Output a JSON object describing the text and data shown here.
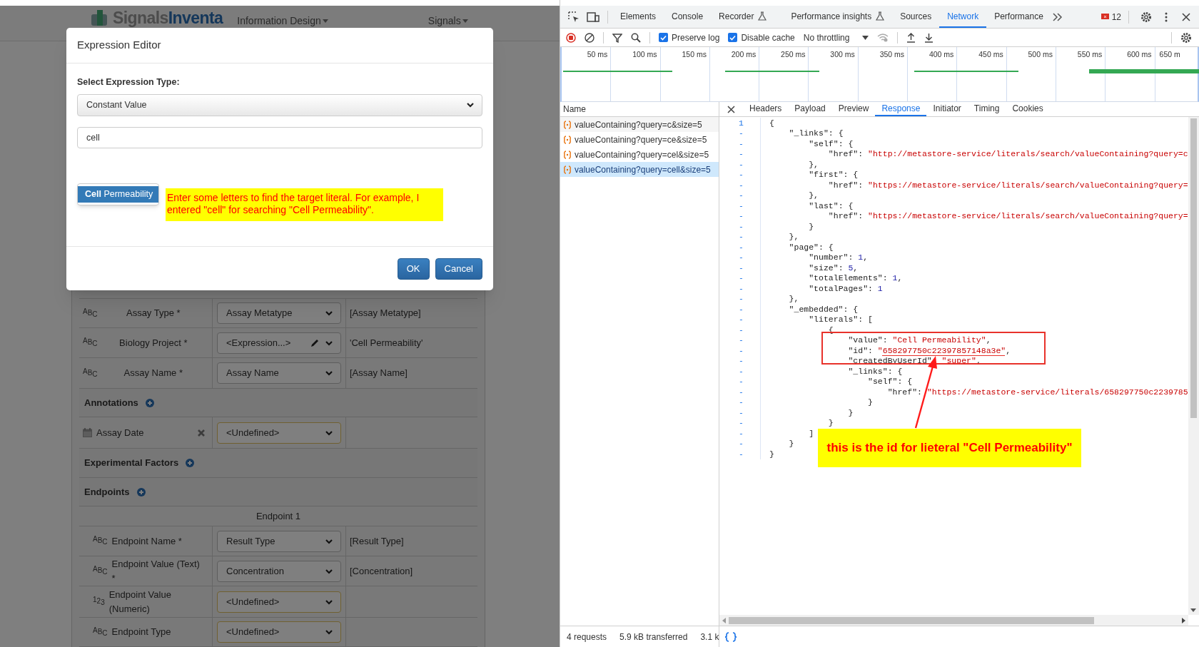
{
  "app": {
    "logo": {
      "prefix": "Signals",
      "suffix": "Inventa"
    },
    "nav": [
      "Information Design",
      "Signals"
    ],
    "form_rows": [
      {
        "kind": "field",
        "type_glyph": "ABC",
        "label": "Assay Type *",
        "select": "Assay Metatype",
        "undefined": false,
        "editable": false,
        "removable": false,
        "value": "[Assay Metatype]"
      },
      {
        "kind": "field",
        "type_glyph": "ABC",
        "label": "Biology Project *",
        "select": "<Expression...>",
        "undefined": false,
        "editable": true,
        "removable": false,
        "value": "'Cell Permeability'"
      },
      {
        "kind": "field",
        "type_glyph": "ABC",
        "label": "Assay Name *",
        "select": "Assay Name",
        "undefined": false,
        "editable": false,
        "removable": false,
        "value": "[Assay Name]"
      },
      {
        "kind": "section",
        "label": "Annotations"
      },
      {
        "kind": "date_field",
        "label": "Assay Date",
        "select": "<Undefined>",
        "undefined": true,
        "editable": false,
        "removable": true
      },
      {
        "kind": "section",
        "label": "Experimental Factors"
      },
      {
        "kind": "section",
        "label": "Endpoints"
      },
      {
        "kind": "subheader",
        "label": "Endpoint 1"
      },
      {
        "kind": "field",
        "type_glyph": "ABC",
        "label": "Endpoint Name *",
        "select": "Result Type",
        "undefined": false,
        "editable": false,
        "removable": false,
        "value": "[Result Type]"
      },
      {
        "kind": "field",
        "type_glyph": "ABC",
        "label": "Endpoint Value (Text) *",
        "select": "Concentration",
        "undefined": false,
        "editable": false,
        "removable": false,
        "value": "[Concentration]"
      },
      {
        "kind": "field",
        "type_glyph": "123",
        "label": "Endpoint Value (Numeric)",
        "select": "<Undefined>",
        "undefined": true,
        "editable": false,
        "removable": false
      },
      {
        "kind": "field",
        "type_glyph": "ABC",
        "label": "Endpoint Type",
        "select": "<Undefined>",
        "undefined": true,
        "editable": false,
        "removable": false
      }
    ]
  },
  "modal": {
    "title": "Expression Editor",
    "type_label": "Select Expression Type:",
    "type_value": "Constant Value",
    "search_value": "cell",
    "suggestions": [
      {
        "label": "**Cell** Permeability",
        "selected": true
      }
    ],
    "note": "Enter some letters to find the target literal. For example, I entered \"cell\" for searching \"Cell Permeability\".",
    "buttons": [
      {
        "label": "OK"
      },
      {
        "label": "Cancel"
      }
    ]
  },
  "devtools": {
    "tabs": [
      {
        "label": "Elements",
        "selected": false,
        "experimental": false
      },
      {
        "label": "Console",
        "selected": false,
        "experimental": false
      },
      {
        "label": "Recorder",
        "selected": false,
        "experimental": true
      },
      {
        "label": "Performance insights",
        "selected": false,
        "experimental": true
      },
      {
        "label": "Sources",
        "selected": false,
        "experimental": false
      },
      {
        "label": "Network",
        "selected": true,
        "experimental": false
      },
      {
        "label": "Performance",
        "selected": false,
        "experimental": false
      }
    ],
    "error_count": "12",
    "preserve_log": {
      "label": "Preserve log",
      "checked": true
    },
    "disable_cache": {
      "label": "Disable cache",
      "checked": true
    },
    "throttling": "No throttling",
    "timeline_ticks": [
      "50 ms",
      "100 ms",
      "150 ms",
      "200 ms",
      "250 ms",
      "300 ms",
      "350 ms",
      "400 ms",
      "450 ms",
      "500 ms",
      "550 ms",
      "600 ms",
      "650 m"
    ],
    "requests_header": "Name",
    "requests": [
      {
        "label": "valueContaining?query=c&size=5",
        "selected": false
      },
      {
        "label": "valueContaining?query=ce&size=5",
        "selected": false
      },
      {
        "label": "valueContaining?query=cel&size=5",
        "selected": false
      },
      {
        "label": "valueContaining?query=cell&size=5",
        "selected": true
      }
    ],
    "detail_tabs": [
      {
        "label": "Headers",
        "selected": false
      },
      {
        "label": "Payload",
        "selected": false
      },
      {
        "label": "Preview",
        "selected": false
      },
      {
        "label": "Response",
        "selected": true
      },
      {
        "label": "Initiator",
        "selected": false
      },
      {
        "label": "Timing",
        "selected": false
      },
      {
        "label": "Cookies",
        "selected": false
      }
    ],
    "response_lines": [
      {
        "gutter": "1",
        "code": "{"
      },
      {
        "gutter": "-",
        "code": "    \"_links\": {"
      },
      {
        "gutter": "-",
        "code": "        \"self\": {"
      },
      {
        "gutter": "-",
        "code": "            \"href\": \"http://metastore-service/literals/search/valueContaining?query=c"
      },
      {
        "gutter": "-",
        "code": "        },"
      },
      {
        "gutter": "-",
        "code": "        \"first\": {"
      },
      {
        "gutter": "-",
        "code": "            \"href\": \"https://metastore-service/literals/search/valueContaining?query="
      },
      {
        "gutter": "-",
        "code": "        },"
      },
      {
        "gutter": "-",
        "code": "        \"last\": {"
      },
      {
        "gutter": "-",
        "code": "            \"href\": \"https://metastore-service/literals/search/valueContaining?query="
      },
      {
        "gutter": "-",
        "code": "        }"
      },
      {
        "gutter": "-",
        "code": "    },"
      },
      {
        "gutter": "-",
        "code": "    \"page\": {"
      },
      {
        "gutter": "-",
        "code": "        \"number\": 1,"
      },
      {
        "gutter": "-",
        "code": "        \"size\": 5,"
      },
      {
        "gutter": "-",
        "code": "        \"totalElements\": 1,"
      },
      {
        "gutter": "-",
        "code": "        \"totalPages\": 1"
      },
      {
        "gutter": "-",
        "code": "    },"
      },
      {
        "gutter": "-",
        "code": "    \"_embedded\": {"
      },
      {
        "gutter": "-",
        "code": "        \"literals\": ["
      },
      {
        "gutter": "-",
        "code": "            {"
      },
      {
        "gutter": "-",
        "code": "                \"value\": \"Cell Permeability\","
      },
      {
        "gutter": "-",
        "code": "                \"id\": \"658297750c22397857148a3e\","
      },
      {
        "gutter": "-",
        "code": "                \"createdByUserId\": \"super\","
      },
      {
        "gutter": "-",
        "code": "                \"_links\": {"
      },
      {
        "gutter": "-",
        "code": "                    \"self\": {"
      },
      {
        "gutter": "-",
        "code": "                        \"href\": \"https://metastore-service/literals/658297750c2239785"
      },
      {
        "gutter": "-",
        "code": "                    }"
      },
      {
        "gutter": "-",
        "code": "                }"
      },
      {
        "gutter": "-",
        "code": "            }"
      },
      {
        "gutter": "-",
        "code": "        ]"
      },
      {
        "gutter": "-",
        "code": "    }"
      },
      {
        "gutter": "-",
        "code": "}"
      }
    ],
    "callout": "this is the id for lieteral \"Cell Permeability\"",
    "status": [
      "4 requests",
      "5.9 kB transferred",
      "3.1 k"
    ]
  }
}
